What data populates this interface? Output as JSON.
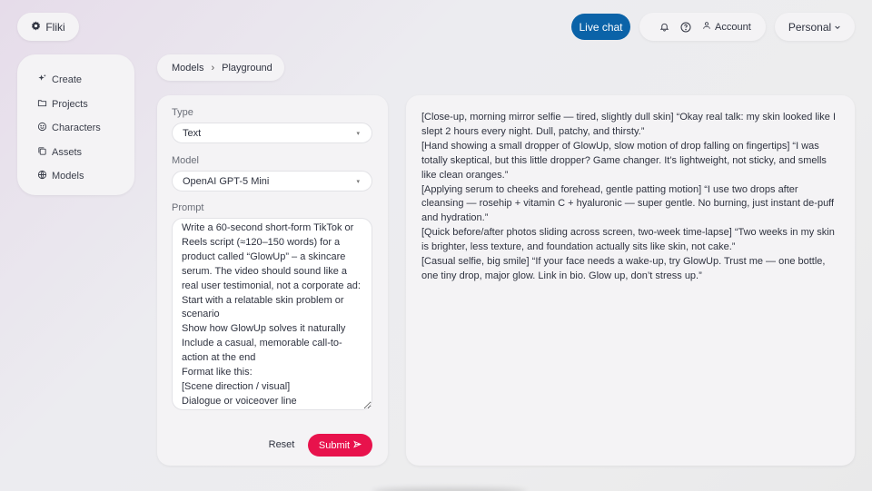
{
  "header": {
    "logo": "Fliki",
    "live_chat": "Live chat",
    "account": "Account",
    "workspace": "Personal"
  },
  "sidebar": {
    "items": [
      {
        "label": "Create",
        "icon": "sparkles-icon"
      },
      {
        "label": "Projects",
        "icon": "folder-icon"
      },
      {
        "label": "Characters",
        "icon": "smiley-icon"
      },
      {
        "label": "Assets",
        "icon": "assets-icon"
      },
      {
        "label": "Models",
        "icon": "globe-icon"
      }
    ]
  },
  "breadcrumb": {
    "parent": "Models",
    "separator": "›",
    "current": "Playground"
  },
  "form": {
    "type_label": "Type",
    "type_value": "Text",
    "model_label": "Model",
    "model_value": "OpenAI GPT-5 Mini",
    "prompt_label": "Prompt",
    "prompt_value": "Write a 60-second short-form TikTok or Reels script (≈120–150 words) for a product called “GlowUp” – a skincare serum. The video should sound like a real user testimonial, not a corporate ad:\nStart with a relatable skin problem or scenario\nShow how GlowUp solves it naturally\nInclude a casual, memorable call-to-action at the end\nFormat like this:\n[Scene direction / visual]\nDialogue or voiceover line",
    "reset_label": "Reset",
    "submit_label": "Submit"
  },
  "output": {
    "paragraphs": [
      "[Close-up, morning mirror selfie — tired, slightly dull skin] “Okay real talk: my skin looked like I slept 2 hours every night. Dull, patchy, and thirsty.”",
      "[Hand showing a small dropper of GlowUp, slow motion of drop falling on fingertips] “I was totally skeptical, but this little dropper? Game changer. It’s lightweight, not sticky, and smells like clean oranges.”",
      "[Applying serum to cheeks and forehead, gentle patting motion] “I use two drops after cleansing — rosehip + vitamin C + hyaluronic — super gentle. No burning, just instant de-puff and hydration.”",
      "[Quick before/after photos sliding across screen, two-week time-lapse] “Two weeks in my skin is brighter, less texture, and foundation actually sits like skin, not cake.”",
      "[Casual selfie, big smile] “If your face needs a wake-up, try GlowUp. Trust me — one bottle, one tiny drop, major glow. Link in bio. Glow up, don’t stress up.”"
    ]
  },
  "colors": {
    "live_chat_bg": "#0b63a8",
    "submit_bg": "#e8124c",
    "panel_bg": "#f4f3f5"
  }
}
